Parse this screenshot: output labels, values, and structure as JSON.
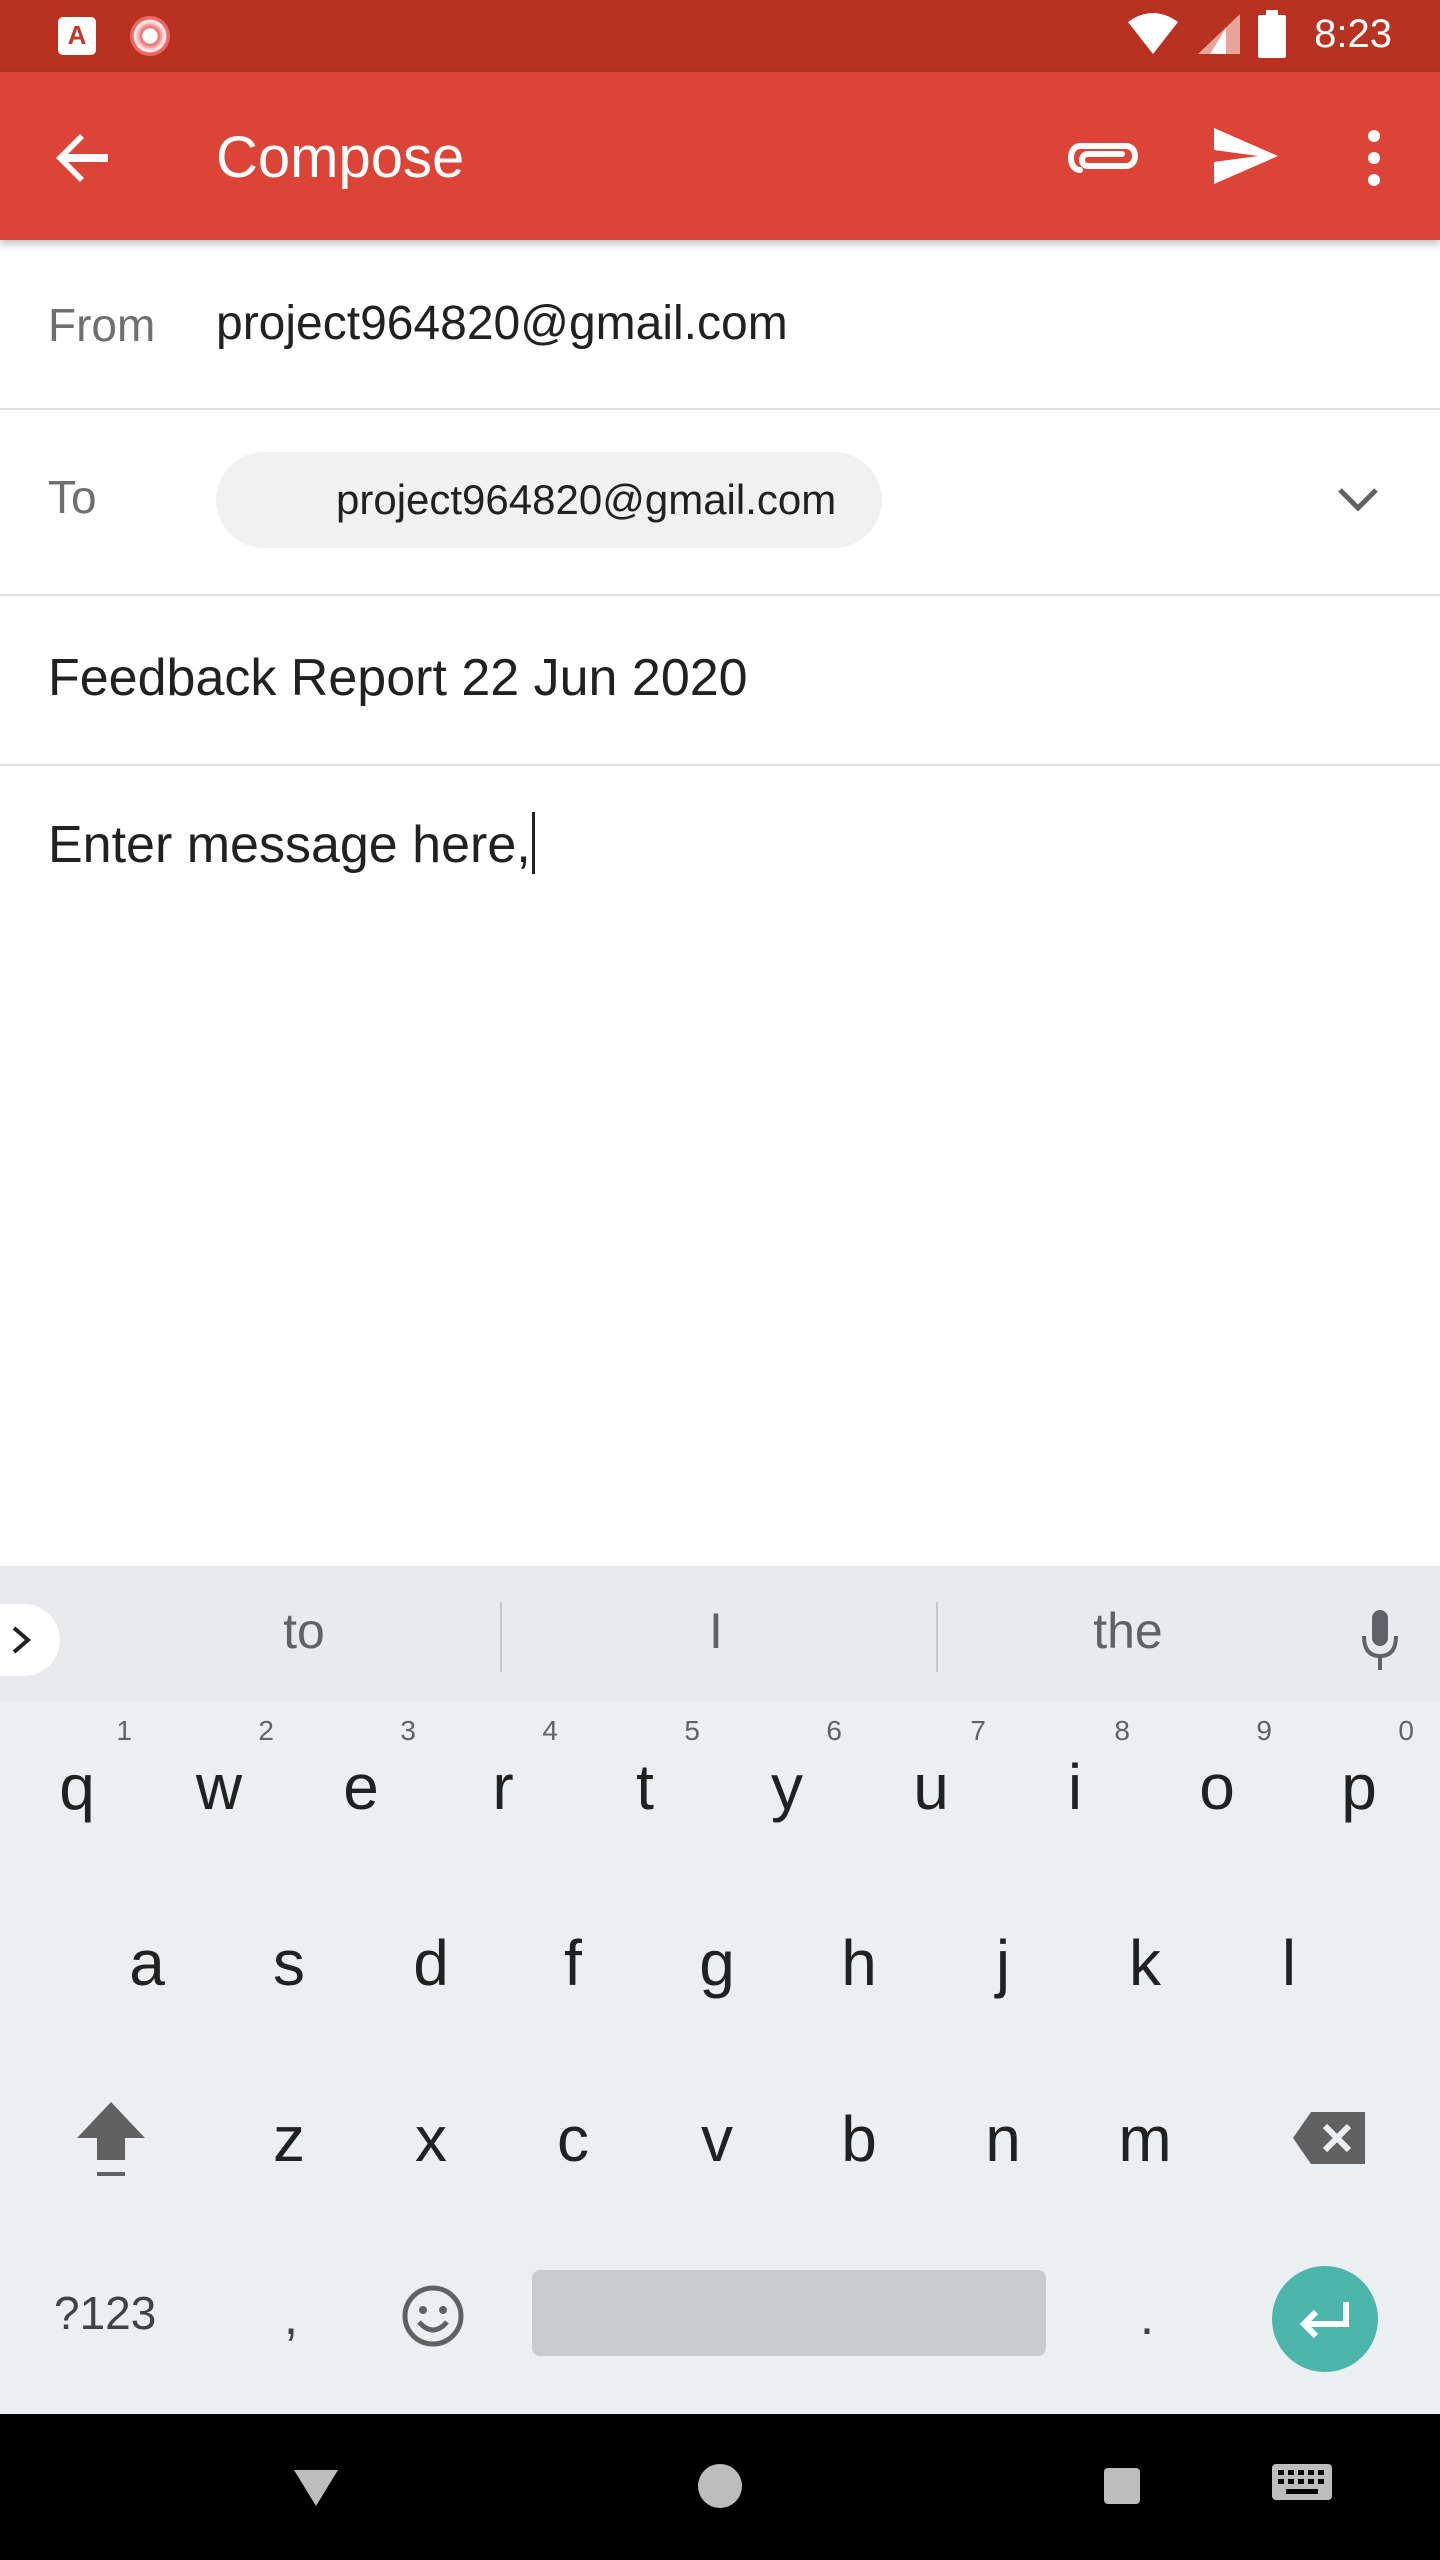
{
  "status_bar": {
    "time": "8:23",
    "app_icon_letter": "A"
  },
  "app_bar": {
    "title": "Compose"
  },
  "from": {
    "label": "From",
    "value": "project964820@gmail.com"
  },
  "to": {
    "label": "To",
    "recipient": "project964820@gmail.com"
  },
  "subject": {
    "value": "Feedback Report 22 Jun 2020"
  },
  "body": {
    "value": "Enter message here,"
  },
  "keyboard": {
    "suggestions": [
      "to",
      "I",
      "the"
    ],
    "row1": [
      {
        "key": "q",
        "hint": "1"
      },
      {
        "key": "w",
        "hint": "2"
      },
      {
        "key": "e",
        "hint": "3"
      },
      {
        "key": "r",
        "hint": "4"
      },
      {
        "key": "t",
        "hint": "5"
      },
      {
        "key": "y",
        "hint": "6"
      },
      {
        "key": "u",
        "hint": "7"
      },
      {
        "key": "i",
        "hint": "8"
      },
      {
        "key": "o",
        "hint": "9"
      },
      {
        "key": "p",
        "hint": "0"
      }
    ],
    "row2": [
      "a",
      "s",
      "d",
      "f",
      "g",
      "h",
      "j",
      "k",
      "l"
    ],
    "row3": [
      "z",
      "x",
      "c",
      "v",
      "b",
      "n",
      "m"
    ],
    "symbols_label": "?123",
    "comma": ",",
    "period": "."
  },
  "colors": {
    "status_bar": "#b93221",
    "app_bar": "#db4437",
    "keyboard_bg": "#eceff1",
    "enter_key": "#4db6ac"
  }
}
